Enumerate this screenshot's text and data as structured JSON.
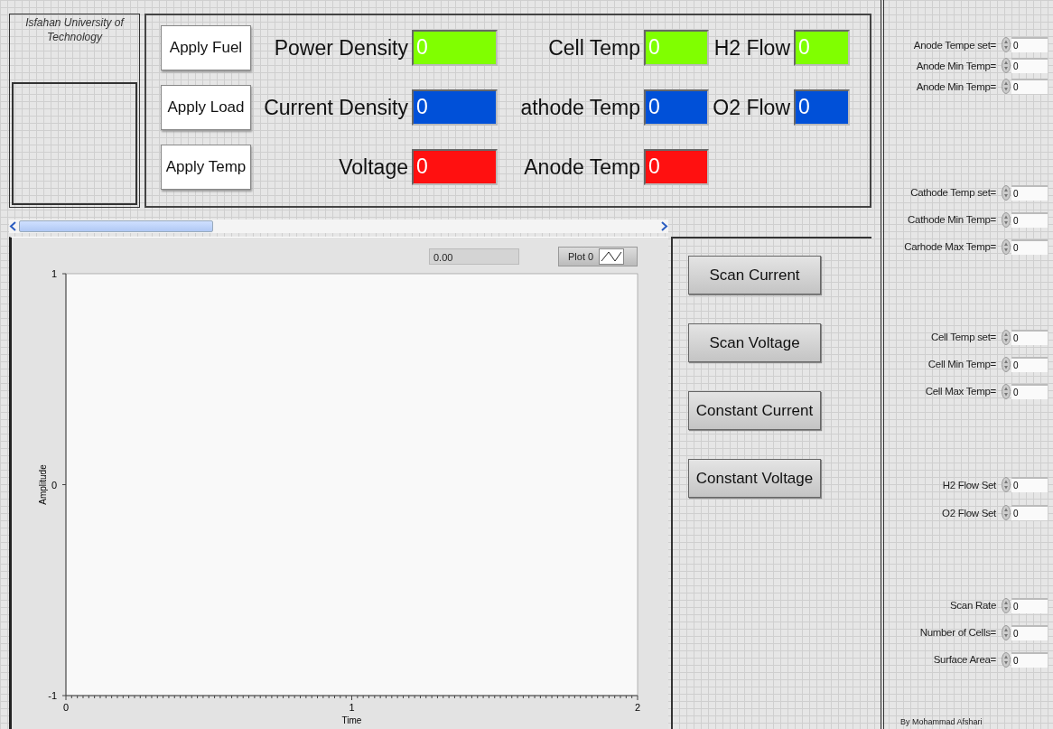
{
  "header": {
    "title": "Isfahan University of Technology"
  },
  "indicator_rows": [
    {
      "button": "Apply Fuel",
      "items": [
        {
          "label": "Power Density",
          "value": "0",
          "color": "#80ff00"
        },
        {
          "label": "Cell Temp",
          "value": "0",
          "color": "#80ff00"
        },
        {
          "label": "H2 Flow",
          "value": "0",
          "color": "#80ff00"
        }
      ]
    },
    {
      "button": "Apply Load",
      "items": [
        {
          "label": "Current Density",
          "value": "0",
          "color": "#0050d8"
        },
        {
          "label": "athode Temp",
          "value": "0",
          "color": "#0050d8"
        },
        {
          "label": "O2 Flow",
          "value": "0",
          "color": "#0050d8"
        }
      ]
    },
    {
      "button": "Apply Temp",
      "items": [
        {
          "label": "Voltage",
          "value": "0",
          "color": "#ff1010"
        },
        {
          "label": "Anode Temp",
          "value": "0",
          "color": "#ff1010"
        }
      ]
    }
  ],
  "graph": {
    "cursor_value": "0.00",
    "legend": "Plot 0",
    "chart_data": {
      "type": "line",
      "xlabel": "Time",
      "ylabel": "Amplitude",
      "xlim": [
        0,
        2
      ],
      "ylim": [
        -1,
        1
      ],
      "xticks": [
        0,
        1,
        2
      ],
      "yticks": [
        -1,
        0,
        1
      ]
    }
  },
  "mode_buttons": [
    "Scan Current",
    "Scan Voltage",
    "Constant Current",
    "Constant Voltage"
  ],
  "settings": {
    "groups": [
      {
        "rows": [
          {
            "label": "Anode Tempe set=",
            "value": "0"
          },
          {
            "label": "Anode Min Temp=",
            "value": "0"
          },
          {
            "label": "Anode Min Temp=",
            "value": "0"
          }
        ]
      },
      {
        "rows": [
          {
            "label": "Cathode Temp set=",
            "value": "0"
          },
          {
            "label": "Cathode Min Temp=",
            "value": "0"
          },
          {
            "label": "Carhode Max Temp=",
            "value": "0"
          }
        ]
      },
      {
        "rows": [
          {
            "label": "Cell Temp set=",
            "value": "0"
          },
          {
            "label": "Cell Min Temp=",
            "value": "0"
          },
          {
            "label": "Cell Max Temp=",
            "value": "0"
          }
        ]
      },
      {
        "rows": [
          {
            "label": "H2 Flow Set",
            "value": "0"
          },
          {
            "label": "O2 Flow Set",
            "value": "0"
          }
        ]
      },
      {
        "rows": [
          {
            "label": "Scan Rate",
            "value": "0"
          },
          {
            "label": "Number of Cells=",
            "value": "0"
          },
          {
            "label": "Surface Area=",
            "value": "0"
          }
        ]
      }
    ],
    "credit": "By Mohammad Afshari"
  }
}
